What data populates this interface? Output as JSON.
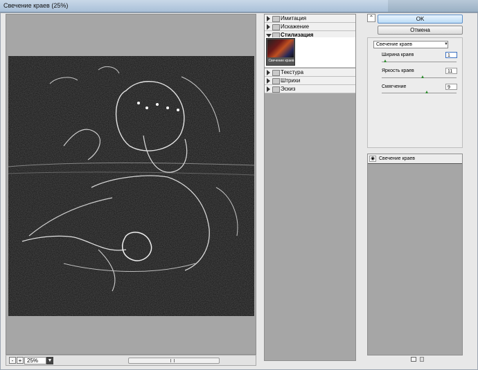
{
  "window": {
    "title": "Свечение краев (25%)"
  },
  "preview": {
    "zoom_value": "25%",
    "zoom_out_label": "-",
    "zoom_in_label": "+"
  },
  "filter_gallery": {
    "categories": [
      {
        "label": "Имитация",
        "expanded": false
      },
      {
        "label": "Искажение",
        "expanded": false
      },
      {
        "label": "Стилизация",
        "expanded": true
      },
      {
        "label": "Текстура",
        "expanded": false
      },
      {
        "label": "Штрихи",
        "expanded": false
      },
      {
        "label": "Эскиз",
        "expanded": false
      }
    ],
    "selected_filter_caption": "Свечение краев"
  },
  "actions": {
    "ok_label": "OK",
    "cancel_label": "Отмена",
    "collapse_icon": "⌃"
  },
  "settings": {
    "filter_select_value": "Свечение краев",
    "params": [
      {
        "label": "Ширина краев",
        "value": "1",
        "slider_fraction": 0.05
      },
      {
        "label": "Яркость краев",
        "value": "11",
        "slider_fraction": 0.55
      },
      {
        "label": "Смягчение",
        "value": "9",
        "slider_fraction": 0.6
      }
    ]
  },
  "layers": {
    "items": [
      {
        "name": "Свечение краев",
        "visible": true
      }
    ]
  },
  "colors": {
    "accent": "#5b8ec8",
    "slider_knob": "#2d8a2d"
  }
}
